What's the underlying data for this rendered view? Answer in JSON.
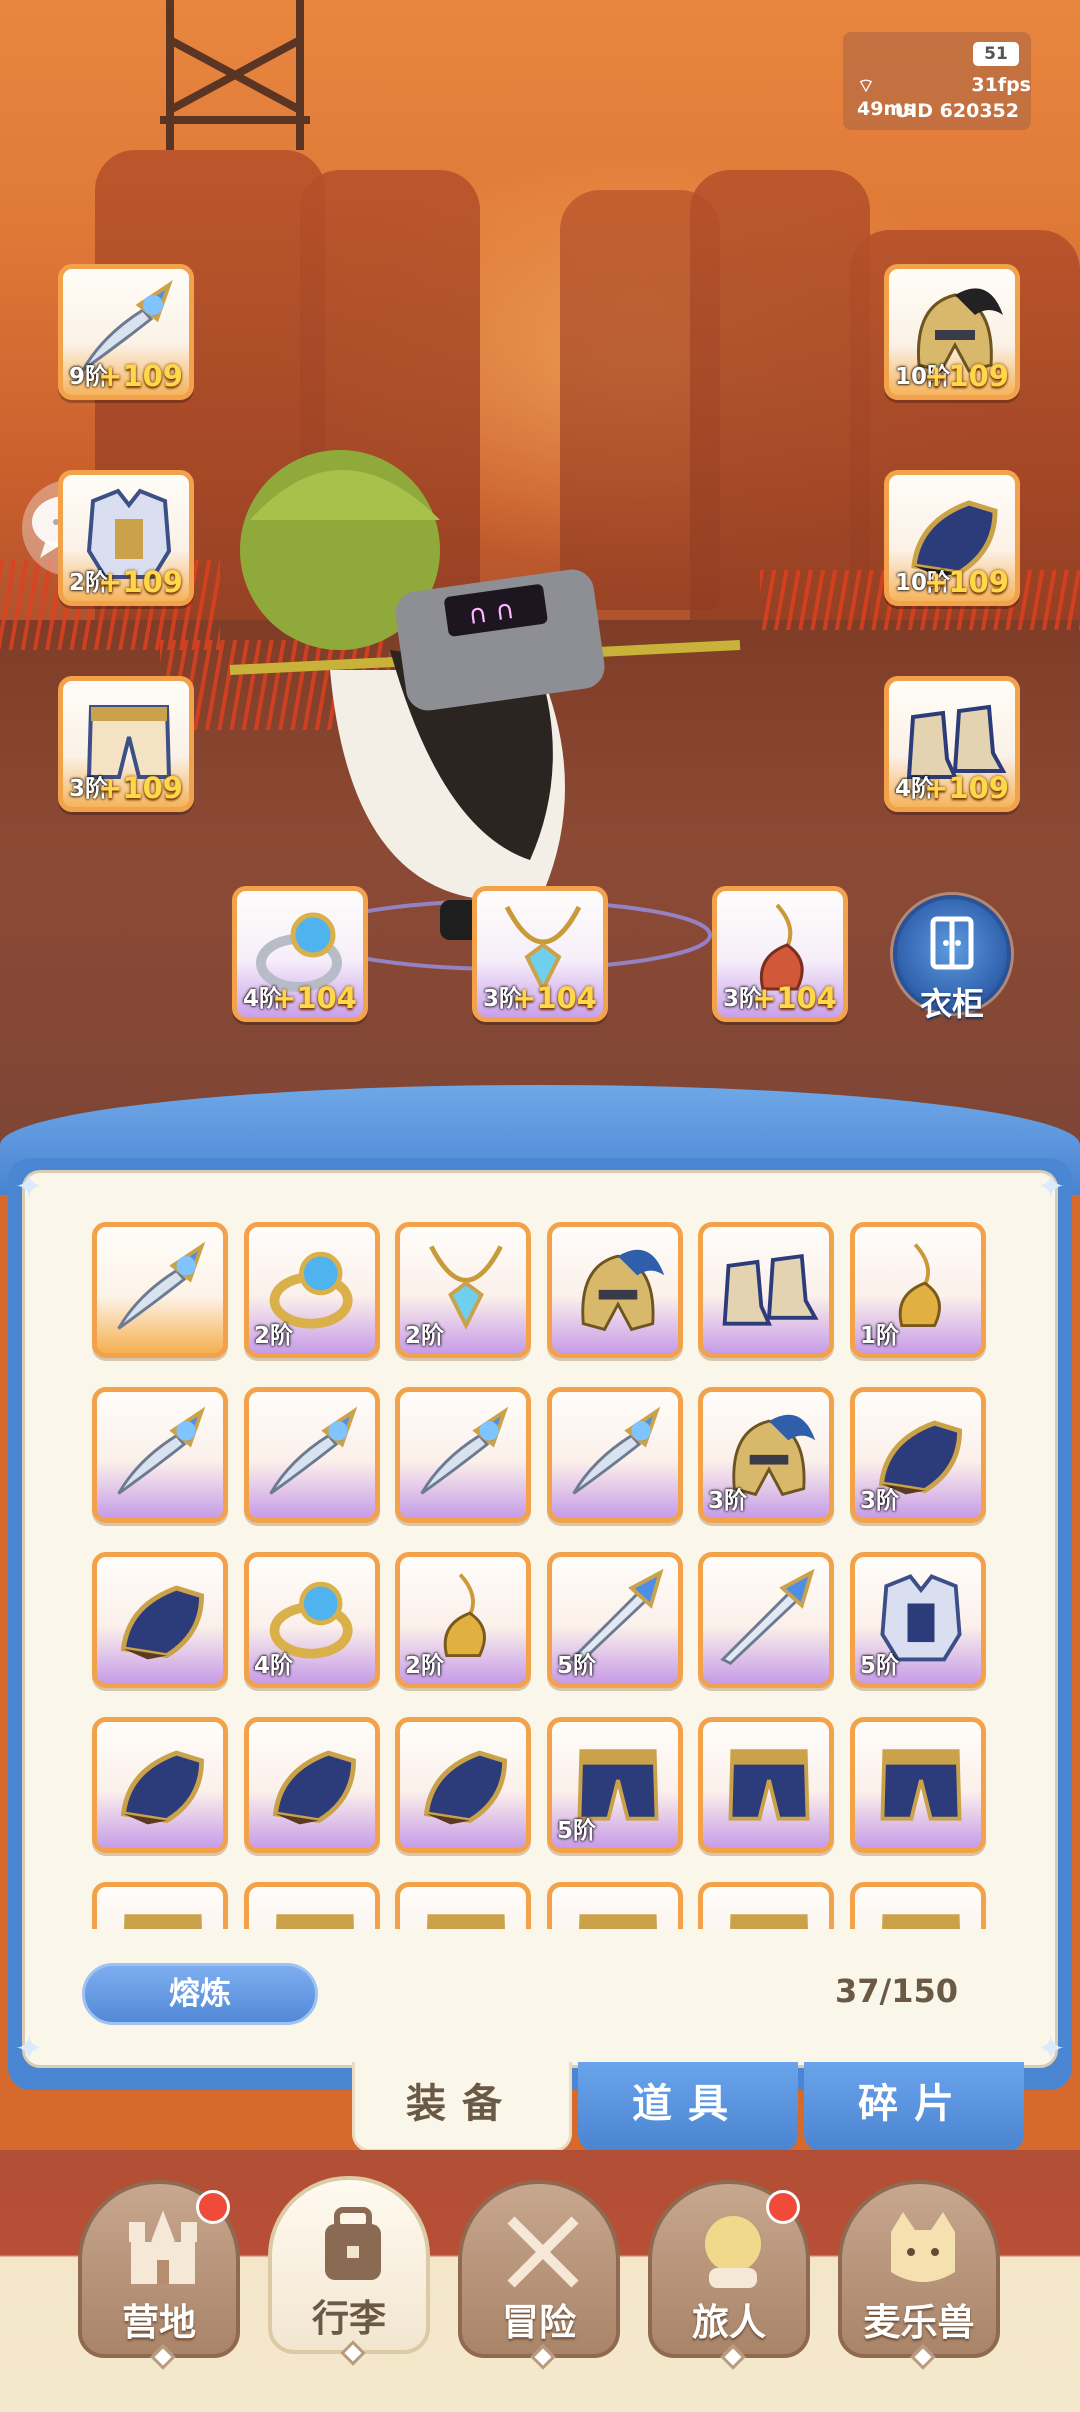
{
  "status": {
    "battery": "51",
    "ping": "49ms",
    "fps": "31fps",
    "uid": "UID 620352"
  },
  "equipped": {
    "weapon": {
      "tier": "9阶",
      "plus": "+109",
      "icon": "curved-dagger"
    },
    "helmet": {
      "tier": "10阶",
      "plus": "+109",
      "icon": "plumed-helmet"
    },
    "gloves": {
      "tier": "2阶",
      "plus": "+109",
      "icon": "armored-gauntlet"
    },
    "gauntlet_right": {
      "tier": "10阶",
      "plus": "+109",
      "icon": "armored-gauntlet"
    },
    "pants": {
      "tier": "3阶",
      "plus": "+109",
      "icon": "armored-pants"
    },
    "boots": {
      "tier": "4阶",
      "plus": "+109",
      "icon": "armored-boots"
    },
    "ring": {
      "tier": "4阶",
      "plus": "+104",
      "icon": "gem-ring"
    },
    "necklace": {
      "tier": "3阶",
      "plus": "+104",
      "icon": "gem-necklace"
    },
    "charm": {
      "tier": "3阶",
      "plus": "+104",
      "icon": "horn-charm"
    }
  },
  "wardrobe_label": "衣柜",
  "inventory": {
    "items": [
      {
        "icon": "curved-dagger",
        "tier": "",
        "frame": "orange"
      },
      {
        "icon": "gem-ring",
        "tier": "2阶",
        "frame": "purple"
      },
      {
        "icon": "gem-necklace",
        "tier": "2阶",
        "frame": "purple"
      },
      {
        "icon": "plumed-helmet",
        "tier": "",
        "frame": "purple"
      },
      {
        "icon": "armored-boots",
        "tier": "",
        "frame": "purple"
      },
      {
        "icon": "horn-charm",
        "tier": "1阶",
        "frame": "purple"
      },
      {
        "icon": "curved-dagger",
        "tier": "",
        "frame": "purple"
      },
      {
        "icon": "curved-dagger",
        "tier": "",
        "frame": "purple"
      },
      {
        "icon": "curved-dagger",
        "tier": "",
        "frame": "purple"
      },
      {
        "icon": "curved-dagger",
        "tier": "",
        "frame": "purple"
      },
      {
        "icon": "plumed-helmet",
        "tier": "3阶",
        "frame": "purple"
      },
      {
        "icon": "armored-gauntlet",
        "tier": "3阶",
        "frame": "purple"
      },
      {
        "icon": "armored-gauntlet",
        "tier": "",
        "frame": "purple"
      },
      {
        "icon": "gem-ring",
        "tier": "4阶",
        "frame": "purple"
      },
      {
        "icon": "horn-charm",
        "tier": "2阶",
        "frame": "purple"
      },
      {
        "icon": "long-sword",
        "tier": "5阶",
        "frame": "purple"
      },
      {
        "icon": "long-sword",
        "tier": "",
        "frame": "purple"
      },
      {
        "icon": "armored-chest",
        "tier": "5阶",
        "frame": "purple"
      },
      {
        "icon": "armored-gauntlet",
        "tier": "",
        "frame": "purple"
      },
      {
        "icon": "armored-gauntlet",
        "tier": "",
        "frame": "purple"
      },
      {
        "icon": "armored-gauntlet",
        "tier": "",
        "frame": "purple"
      },
      {
        "icon": "armored-pants",
        "tier": "5阶",
        "frame": "purple"
      },
      {
        "icon": "armored-pants",
        "tier": "",
        "frame": "purple"
      },
      {
        "icon": "armored-pants",
        "tier": "",
        "frame": "purple"
      },
      {
        "icon": "armored-pants",
        "tier": "",
        "frame": "purple"
      },
      {
        "icon": "armored-pants",
        "tier": "",
        "frame": "purple"
      },
      {
        "icon": "armored-pants",
        "tier": "",
        "frame": "purple"
      },
      {
        "icon": "armored-pants",
        "tier": "",
        "frame": "purple"
      },
      {
        "icon": "armored-pants",
        "tier": "",
        "frame": "purple"
      },
      {
        "icon": "armored-pants",
        "tier": "",
        "frame": "purple"
      }
    ],
    "smelt_label": "熔炼",
    "count": "37/150"
  },
  "tabs": {
    "equip": "装备",
    "items": "道具",
    "fragments": "碎片"
  },
  "nav": [
    {
      "label": "营地",
      "icon": "castle-icon",
      "badge": true
    },
    {
      "label": "行李",
      "icon": "backpack-icon",
      "badge": false,
      "active": true
    },
    {
      "label": "冒险",
      "icon": "crossed-swords-icon",
      "badge": false
    },
    {
      "label": "旅人",
      "icon": "character-icon",
      "badge": true
    },
    {
      "label": "麦乐兽",
      "icon": "cat-icon",
      "badge": false
    }
  ],
  "colors": {
    "tier_orange": "#f2a24a",
    "tier_purple": "#c79ce8",
    "panel_blue": "#4b86d3",
    "plus_gold": "#ffd84a"
  }
}
